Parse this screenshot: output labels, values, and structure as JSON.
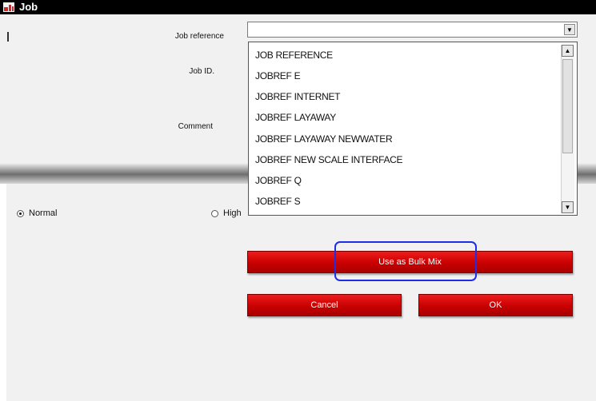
{
  "window": {
    "title": "Job"
  },
  "form": {
    "job_reference_label": "Job reference",
    "job_id_label": "Job ID.",
    "comment_label": "Comment",
    "job_reference_value": ""
  },
  "dropdown": {
    "items": [
      "JOB REFERENCE",
      "JOBREF E",
      "JOBREF INTERNET",
      "JOBREF LAYAWAY",
      "JOBREF LAYAWAY NEWWATER",
      "JOBREF NEW SCALE INTERFACE",
      "JOBREF Q",
      "JOBREF S"
    ]
  },
  "priority": {
    "normal_label": "Normal",
    "high_label": "High",
    "selected": "Normal"
  },
  "buttons": {
    "bulk_mix": "Use as Bulk Mix",
    "cancel": "Cancel",
    "ok": "OK"
  },
  "colors": {
    "button_red": "#d40000",
    "highlight_blue": "#1f2ee6",
    "title_bar": "#000000"
  }
}
